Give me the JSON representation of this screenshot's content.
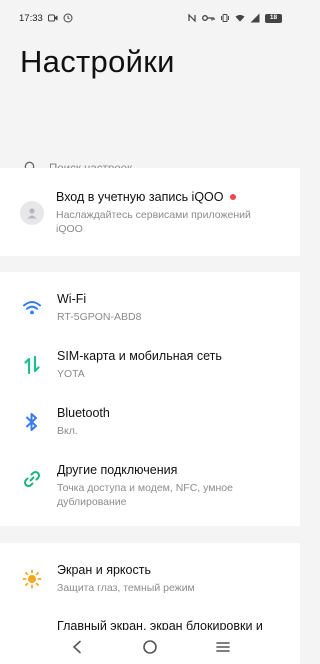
{
  "status_bar": {
    "time": "17:33",
    "battery": "18"
  },
  "title": "Настройки",
  "search": {
    "placeholder": "Поиск настроек"
  },
  "account": {
    "title": "Вход в учетную запись iQOO",
    "subtitle_line1": "Наслаждайтесь сервисами приложений",
    "subtitle_line2": "iQOO"
  },
  "network": [
    {
      "title": "Wi-Fi",
      "subtitle": "RT-5GPON-ABD8",
      "icon": "wifi-icon"
    },
    {
      "title": "SIM-карта и мобильная сеть",
      "subtitle": "YOTA",
      "icon": "sim-data-icon"
    },
    {
      "title": "Bluetooth",
      "subtitle": "Вкл.",
      "icon": "bluetooth-icon"
    },
    {
      "title": "Другие подключения",
      "subtitle_line1": "Точка доступа и модем, NFC, умное",
      "subtitle_line2": "дублирование",
      "icon": "link-icon"
    }
  ],
  "display": [
    {
      "title": "Экран и яркость",
      "subtitle": "Защита глаз, темный режим",
      "icon": "brightness-icon"
    },
    {
      "title": "Главный экран, экран блокировки и"
    }
  ],
  "colors": {
    "wifi": "#2f7cf6",
    "sim": "#1fbf8f",
    "bluetooth": "#3a79f0",
    "link": "#19b77f",
    "brightness": "#f5a623",
    "notification_dot": "#f0464f"
  }
}
